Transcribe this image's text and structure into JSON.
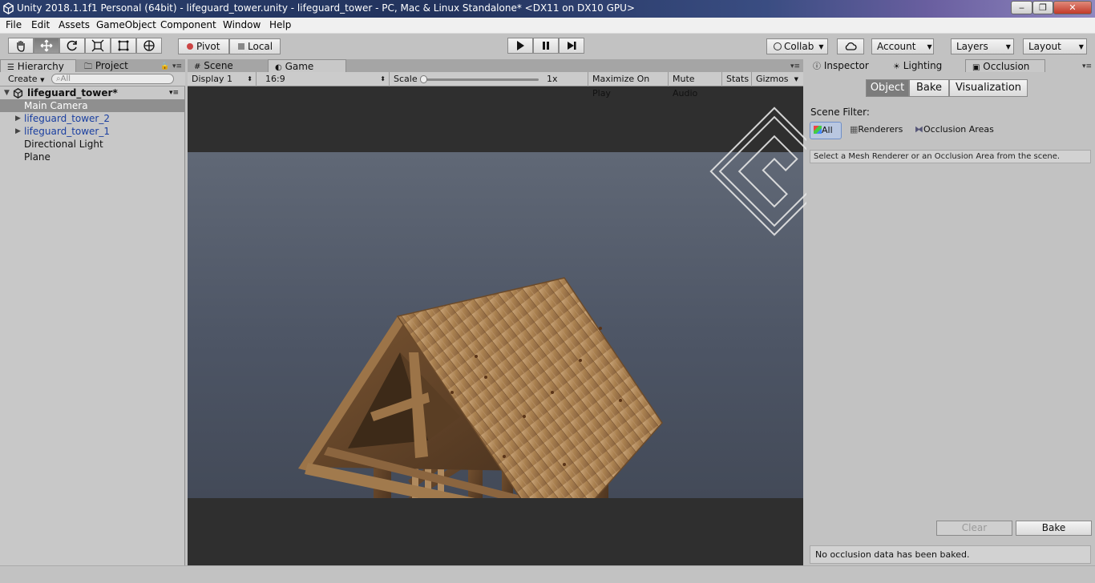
{
  "window": {
    "title": "Unity 2018.1.1f1 Personal (64bit) - lifeguard_tower.unity - lifeguard_tower - PC, Mac & Linux Standalone* <DX11 on DX10 GPU>",
    "minimize": "‒",
    "maximize": "❐",
    "close": "✕"
  },
  "menu": [
    "File",
    "Edit",
    "Assets",
    "GameObject",
    "Component",
    "Window",
    "Help"
  ],
  "toolbar": {
    "pivot": "Pivot",
    "local": "Local",
    "collab": "Collab",
    "account": "Account",
    "layers": "Layers",
    "layout": "Layout"
  },
  "hierarchy": {
    "tabs": [
      "Hierarchy",
      "Project"
    ],
    "create": "Create",
    "search_placeholder": "All",
    "scene": "lifeguard_tower*",
    "items": [
      {
        "label": "Main Camera"
      },
      {
        "label": "lifeguard_tower_2"
      },
      {
        "label": "lifeguard_tower_1"
      },
      {
        "label": "Directional Light"
      },
      {
        "label": "Plane"
      }
    ]
  },
  "center": {
    "tabs": [
      "Scene",
      "Game"
    ],
    "display": "Display 1",
    "aspect": "16:9",
    "scale_label": "Scale",
    "scale_value": "1x",
    "maximize_on_play": "Maximize On Play",
    "mute_audio": "Mute Audio",
    "stats": "Stats",
    "gizmos": "Gizmos"
  },
  "right": {
    "tabs": [
      "Inspector",
      "Lighting",
      "Occlusion"
    ],
    "segments": [
      "Object",
      "Bake",
      "Visualization"
    ],
    "scene_filter_label": "Scene Filter:",
    "filters": [
      "All",
      "Renderers",
      "Occlusion Areas"
    ],
    "help": "Select a Mesh Renderer or an Occlusion Area from the scene.",
    "clear": "Clear",
    "bake": "Bake",
    "status": "No occlusion data has been baked."
  }
}
